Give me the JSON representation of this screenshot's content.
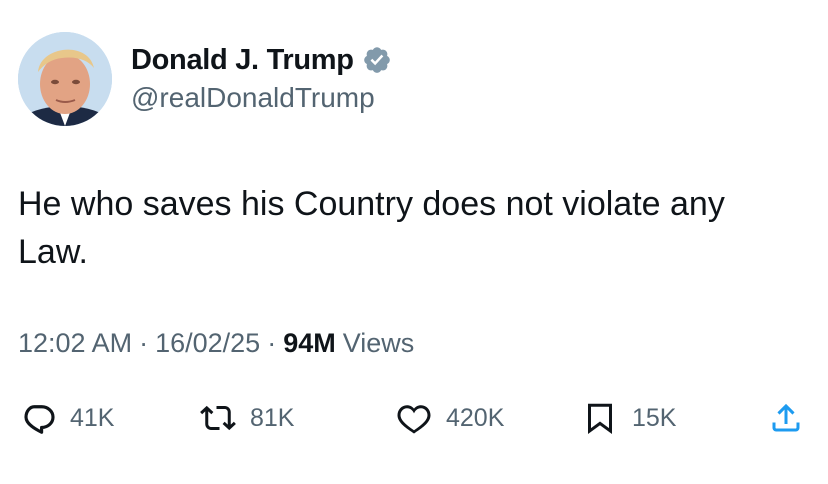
{
  "author": {
    "name": "Donald J. Trump",
    "handle": "@realDonaldTrump",
    "verified": true
  },
  "tweet": {
    "text": "He who saves his Country does not violate any Law."
  },
  "meta": {
    "time": "12:02 AM",
    "separator": "·",
    "date": "16/02/25",
    "views_count": "94M",
    "views_label": "Views"
  },
  "actions": {
    "reply_count": "41K",
    "retweet_count": "81K",
    "like_count": "420K",
    "bookmark_count": "15K"
  },
  "icons": {
    "verified": "verified-badge-icon",
    "reply": "reply-bubble-icon",
    "retweet": "retweet-arrows-icon",
    "like": "heart-icon",
    "bookmark": "bookmark-icon",
    "share": "share-upload-icon"
  },
  "colors": {
    "text_primary": "#0f1419",
    "text_secondary": "#536471",
    "verified_badge": "#829aab"
  }
}
